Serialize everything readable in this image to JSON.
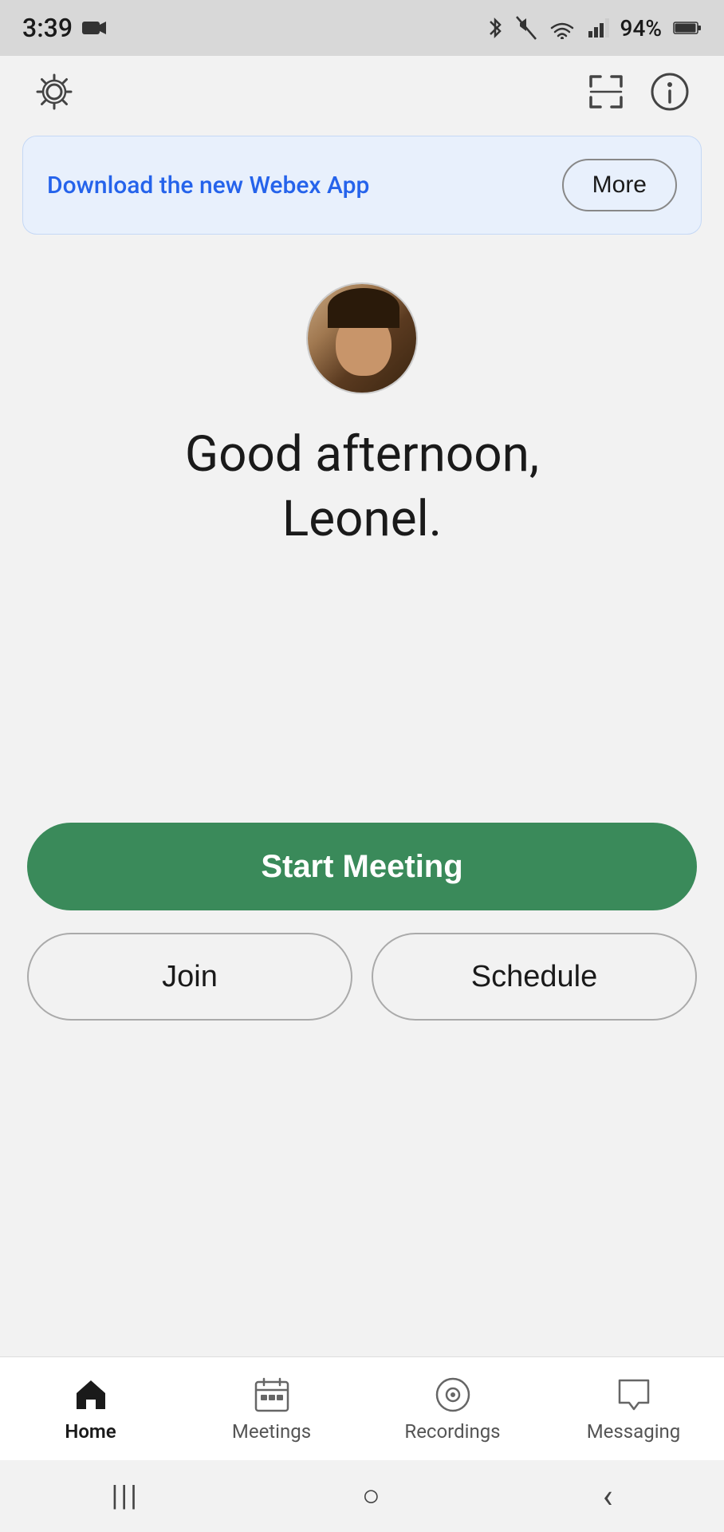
{
  "status_bar": {
    "time": "3:39",
    "battery": "94%"
  },
  "header": {
    "settings_icon": "gear-icon",
    "scan_icon": "scan-icon",
    "info_icon": "info-icon"
  },
  "banner": {
    "text": "Download the new Webex App",
    "button_label": "More"
  },
  "greeting": {
    "line1": "Good afternoon,",
    "line2": "Leonel."
  },
  "buttons": {
    "start_meeting": "Start Meeting",
    "join": "Join",
    "schedule": "Schedule"
  },
  "bottom_nav": {
    "items": [
      {
        "label": "Home",
        "icon": "home-icon",
        "active": true
      },
      {
        "label": "Meetings",
        "icon": "meetings-icon",
        "active": false
      },
      {
        "label": "Recordings",
        "icon": "recordings-icon",
        "active": false
      },
      {
        "label": "Messaging",
        "icon": "messaging-icon",
        "active": false
      }
    ]
  },
  "system_nav": {
    "back": "‹",
    "home": "○",
    "recents": "|||"
  },
  "colors": {
    "start_meeting_bg": "#3a8a5a",
    "banner_bg": "#e8f0fc",
    "banner_text": "#2563eb"
  }
}
